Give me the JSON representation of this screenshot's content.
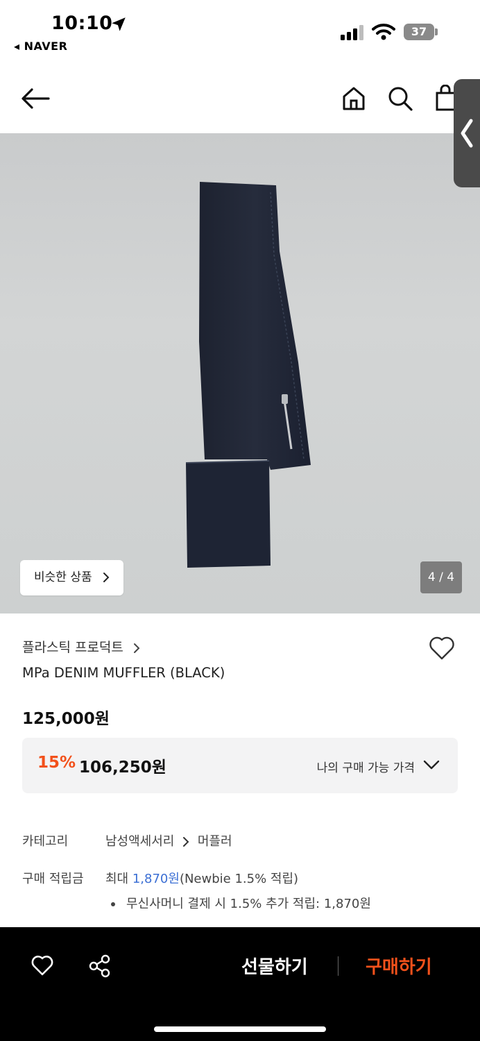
{
  "status_bar": {
    "time": "10:10",
    "back_app": "◂ NAVER",
    "battery": "37"
  },
  "icons": {
    "location": "location-arrow-icon",
    "signal": "signal-icon",
    "wifi": "wifi-icon",
    "battery": "battery-icon",
    "back": "arrow-left-icon",
    "home": "home-icon",
    "search": "search-icon",
    "cart": "shopping-bag-icon",
    "side_tab": "chevron-left-icon",
    "favorite": "heart-icon",
    "share": "share-icon",
    "dropdown": "chevron-down-icon",
    "chevron": "chevron-right-icon"
  },
  "image": {
    "similar_button": "비슷한 상품",
    "page_indicator": "4 / 4",
    "current_page": 4,
    "total_pages": 4
  },
  "product": {
    "brand": "플라스틱 프로덕트",
    "title": "MPa DENIM MUFFLER (BLACK)",
    "original_price": "125,000원",
    "discount_percent": "15%",
    "sale_price": "106,250원",
    "my_price_label": "나의 구매 가능 가격"
  },
  "info": {
    "category_label": "카테고리",
    "category_path": [
      "남성액세서리",
      "머플러"
    ],
    "points_label": "구매 적립금",
    "points_prefix": "최대 ",
    "points_amount": "1,870원",
    "points_suffix": "(Newbie 1.5% 적립)",
    "points_bullet": "무신사머니 결제 시 1.5% 추가 적립: 1,870원"
  },
  "bottom_bar": {
    "gift_label": "선물하기",
    "buy_label": "구매하기"
  },
  "colors": {
    "accent": "#f2511b",
    "link": "#3b6fd4",
    "bottom_bar": "#000000",
    "sale_box": "#f3f3f4"
  }
}
